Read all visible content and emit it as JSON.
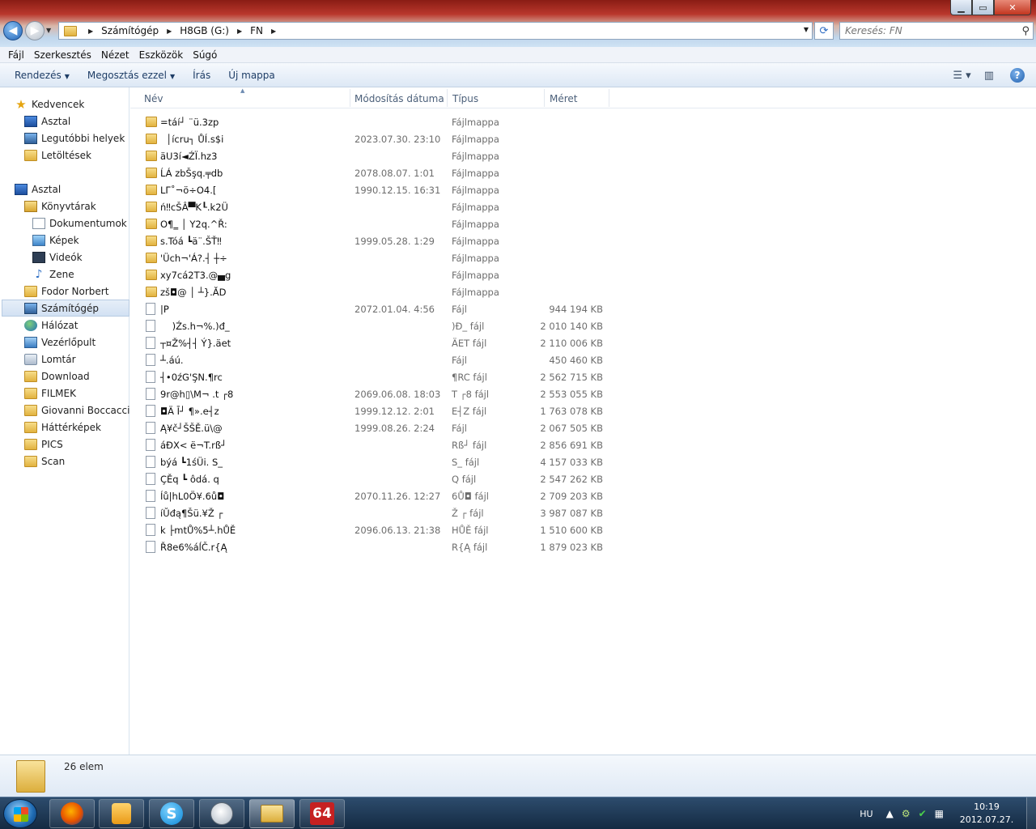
{
  "window": {
    "caption_buttons": {
      "minimize": "▁",
      "maximize": "▭",
      "close": "✕"
    }
  },
  "address": {
    "crumbs": [
      "Számítógép",
      "H8GB (G:)",
      "FN"
    ]
  },
  "search": {
    "placeholder": "Keresés: FN"
  },
  "menubar": [
    "Fájl",
    "Szerkesztés",
    "Nézet",
    "Eszközök",
    "Súgó"
  ],
  "toolbar": {
    "organize": "Rendezés",
    "share": "Megosztás ezzel",
    "burn": "Írás",
    "new_folder": "Új mappa",
    "help": "?"
  },
  "sidebar": {
    "favorites": {
      "label": "Kedvencek",
      "items": [
        "Asztal",
        "Legutóbbi helyek",
        "Letöltések"
      ]
    },
    "desktop": "Asztal",
    "libraries": {
      "label": "Könyvtárak",
      "items": [
        "Dokumentumok",
        "Képek",
        "Videók",
        "Zene"
      ]
    },
    "user": "Fodor Norbert",
    "computer": "Számítógép",
    "network": "Hálózat",
    "control_panel": "Vezérlőpult",
    "recycle_bin": "Lomtár",
    "folders": [
      "Download",
      "FILMEK",
      "Giovanni Boccaccio",
      "Háttérképek",
      "PICS",
      "Scan"
    ]
  },
  "columns": {
    "name": "Név",
    "date": "Módosítás dátuma",
    "type": "Típus",
    "size": "Méret"
  },
  "files": [
    {
      "icon": "folder",
      "name": "=táí┘ ¨ü.3zp",
      "date": "",
      "type": "Fájlmappa",
      "size": ""
    },
    {
      "icon": "folder",
      "name": "  │ícru┐ ŮÍ.s$i",
      "date": "2023.07.30. 23:10",
      "type": "Fájlmappa",
      "size": ""
    },
    {
      "icon": "folder",
      "name": "äU3í◄ŹΪ.hz3",
      "date": "",
      "type": "Fájlmappa",
      "size": ""
    },
    {
      "icon": "folder",
      "name": "ĹÁ zbŠşq.╤db",
      "date": "2078.08.07. 1:01",
      "type": "Fájlmappa",
      "size": ""
    },
    {
      "icon": "folder",
      "name": "LΓ˚¬ö÷O4.[",
      "date": "1990.12.15. 16:31",
      "type": "Fájlmappa",
      "size": ""
    },
    {
      "icon": "folder",
      "name": "ń‼cŠÂ▀K┖.k2Ü",
      "date": "",
      "type": "Fájlmappa",
      "size": ""
    },
    {
      "icon": "folder",
      "name": "O¶‗ │ Y2q.^Ř:",
      "date": "",
      "type": "Fájlmappa",
      "size": ""
    },
    {
      "icon": "folder",
      "name": "s.Tóá ┗ä¨.ŠŤ‼",
      "date": "1999.05.28. 1:29",
      "type": "Fájlmappa",
      "size": ""
    },
    {
      "icon": "folder",
      "name": "'Üch¬'Á?.┤ ┼÷",
      "date": "",
      "type": "Fájlmappa",
      "size": ""
    },
    {
      "icon": "folder",
      "name": "xy7cá2T3.@▄g",
      "date": "",
      "type": "Fájlmappa",
      "size": ""
    },
    {
      "icon": "folder",
      "name": "zš◘@ │ ┴}.ĂD",
      "date": "",
      "type": "Fájlmappa",
      "size": ""
    },
    {
      "icon": "file",
      "name": "|P",
      "date": "2072.01.04. 4:56",
      "type": "Fájl",
      "size": "944 194 KB"
    },
    {
      "icon": "file",
      "name": "    )Źs.h¬%.)đ_",
      "date": "",
      "type": ")Đ_ fájl",
      "size": "2 010 140 KB"
    },
    {
      "icon": "file",
      "name": "┬¤Ž%┤┤ Ý}.äet",
      "date": "",
      "type": "ÄET fájl",
      "size": "2 110 006 KB"
    },
    {
      "icon": "file",
      "name": "┴.áú.",
      "date": "",
      "type": "Fájl",
      "size": "450 460 KB"
    },
    {
      "icon": "file",
      "name": "┤•0źG'ŞN.¶rc",
      "date": "",
      "type": "¶RC fájl",
      "size": "2 562 715 KB"
    },
    {
      "icon": "file",
      "name": "9r@h▯\\M¬ .t ┌8",
      "date": "2069.06.08. 18:03",
      "type": "T ┌8 fájl",
      "size": "2 553 055 KB"
    },
    {
      "icon": "file",
      "name": "◘Ä Ī┘ ¶».e┤z",
      "date": "1999.12.12. 2:01",
      "type": "E┤Z fájl",
      "size": "1 763 078 KB"
    },
    {
      "icon": "file",
      "name": "Ą¥č┘ŠŠĚ.ü\\@",
      "date": "1999.08.26. 2:24",
      "type": "Fájl",
      "size": "2 067 505 KB"
    },
    {
      "icon": "file",
      "name": "áĐX< ë¬T.rß┘",
      "date": "",
      "type": "Rß┘ fájl",
      "size": "2 856 691 KB"
    },
    {
      "icon": "file",
      "name": "bý⁠á ┗1śÜi. S_",
      "date": "",
      "type": "S_ fájl",
      "size": "4 157 033 KB"
    },
    {
      "icon": "file",
      "name": "ÇĚq ┗ ôdá. q",
      "date": "",
      "type": "Q fájl",
      "size": "2 547 262 KB"
    },
    {
      "icon": "file",
      "name": "Íů|hL0Ö¥.6ů◘",
      "date": "2070.11.26. 12:27",
      "type": "6Ů◘ fájl",
      "size": "2 709 203 KB"
    },
    {
      "icon": "file",
      "name": "íŬđą¶Šü.¥Ž ┌",
      "date": "",
      "type": "Ž ┌ fájl",
      "size": "3 987 087 KB"
    },
    {
      "icon": "file",
      "name": "k ├mtŮ%5┴.hŮĚ",
      "date": "2096.06.13. 21:38",
      "type": "HŮĚ fájl",
      "size": "1 510 600 KB"
    },
    {
      "icon": "file",
      "name": "Ř8e6%áĺČ.r{Ą",
      "date": "",
      "type": "R{Ą fájl",
      "size": "1 879 023 KB"
    }
  ],
  "details": {
    "count": "26 elem"
  },
  "taskbar": {
    "apps": [
      "firefox",
      "media-player",
      "skype",
      "clock-app",
      "explorer",
      "c64"
    ],
    "c64_label": "64",
    "lang": "HU",
    "time": "10:19",
    "date": "2012.07.27."
  },
  "colors": {
    "accent": "#1e3d66",
    "titlebar_red": "#b9372c",
    "folder": "#e2b23f"
  }
}
